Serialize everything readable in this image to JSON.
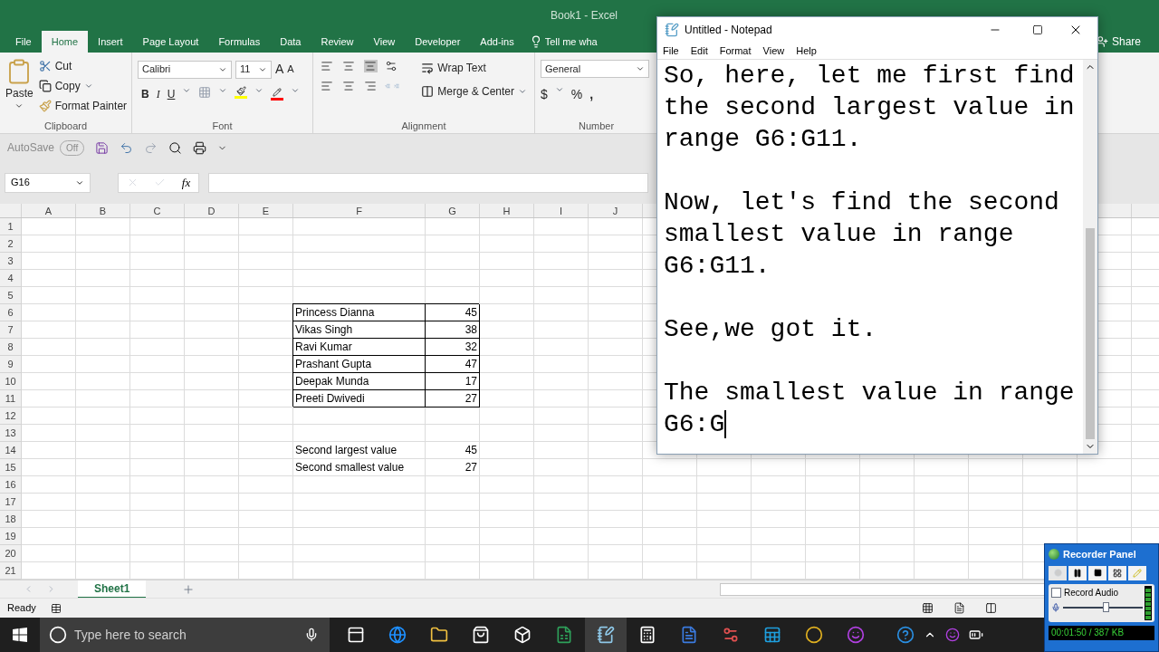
{
  "excel": {
    "title": "Book1  -  Excel",
    "tabs": [
      {
        "label": "File",
        "selected": false
      },
      {
        "label": "Home",
        "selected": true
      },
      {
        "label": "Insert",
        "selected": false
      },
      {
        "label": "Page Layout",
        "selected": false
      },
      {
        "label": "Formulas",
        "selected": false
      },
      {
        "label": "Data",
        "selected": false
      },
      {
        "label": "Review",
        "selected": false
      },
      {
        "label": "View",
        "selected": false
      },
      {
        "label": "Developer",
        "selected": false
      },
      {
        "label": "Add-ins",
        "selected": false
      }
    ],
    "tell_me": "Tell me wha",
    "share": "Share",
    "clipboard": {
      "paste": "Paste",
      "cut": "Cut",
      "copy": "Copy",
      "format_painter": "Format Painter",
      "group": "Clipboard"
    },
    "font": {
      "name": "Calibri",
      "size": "11",
      "grow": "A",
      "shrink": "A",
      "bold": "B",
      "italic": "I",
      "underline": "U",
      "group": "Font"
    },
    "alignment": {
      "wrap_text": "Wrap Text",
      "merge_center": "Merge & Center",
      "group": "Alignment"
    },
    "number": {
      "format": "General",
      "currency": "$",
      "percent": "%",
      "comma": ",",
      "group": "Number"
    },
    "autosave": {
      "label": "AutoSave",
      "state": "Off",
      "on": false
    },
    "name_box": "G16",
    "function_label": "fx",
    "columns": [
      "A",
      "B",
      "C",
      "D",
      "E",
      "F",
      "G",
      "H",
      "I",
      "J"
    ],
    "rows": [
      {
        "number": "1"
      },
      {
        "number": "2"
      },
      {
        "number": "3"
      },
      {
        "number": "4"
      },
      {
        "number": "5"
      },
      {
        "number": "6",
        "name": "Princess Dianna",
        "value": "45",
        "boxed": true
      },
      {
        "number": "7",
        "name": "Vikas Singh",
        "value": "38",
        "boxed": true
      },
      {
        "number": "8",
        "name": "Ravi Kumar",
        "value": "32",
        "boxed": true
      },
      {
        "number": "9",
        "name": "Prashant Gupta",
        "value": "47",
        "boxed": true
      },
      {
        "number": "10",
        "name": "Deepak Munda",
        "value": "17",
        "boxed": true
      },
      {
        "number": "11",
        "name": "Preeti Dwivedi",
        "value": "27",
        "boxed": true
      },
      {
        "number": "12"
      },
      {
        "number": "13"
      },
      {
        "number": "14",
        "name": "Second largest value",
        "value": "45",
        "boxed": false
      },
      {
        "number": "15",
        "name": "Second smallest value",
        "value": "27",
        "boxed": false
      },
      {
        "number": "16"
      },
      {
        "number": "17"
      },
      {
        "number": "18"
      },
      {
        "number": "19"
      },
      {
        "number": "20"
      },
      {
        "number": "21"
      }
    ],
    "sheet_tabs": [
      {
        "label": "Sheet1",
        "selected": true
      }
    ],
    "status": "Ready"
  },
  "notepad": {
    "title": "Untitled - Notepad",
    "menu": [
      "File",
      "Edit",
      "Format",
      "View",
      "Help"
    ],
    "paragraphs": [
      "So, here, let me first find the second largest value in range G6:G11.",
      "Now, let's find the second smallest value in range G6:G11.",
      "See,we got it.",
      "The smallest value in range G6:G"
    ]
  },
  "taskbar": {
    "search": {
      "placeholder": "Type here to search"
    }
  },
  "recorder": {
    "title": "Recorder Panel",
    "record_audio": {
      "label": "Record Audio",
      "checked": false
    },
    "volume": {
      "level": 0.55
    },
    "readout": "00:01:50 / 387 KB"
  }
}
